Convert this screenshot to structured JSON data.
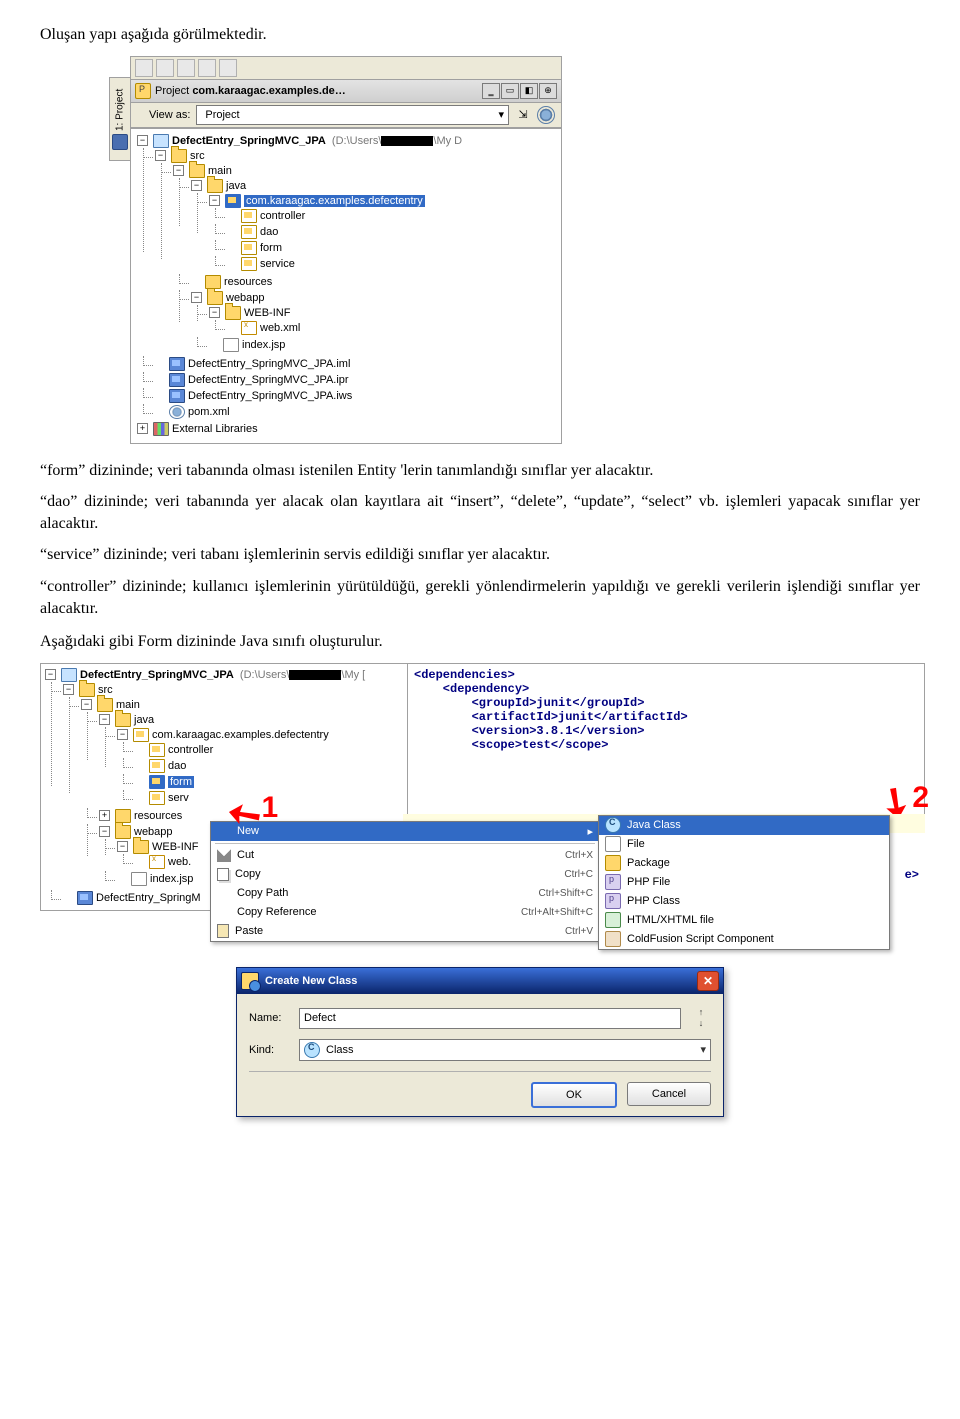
{
  "intro_line": "Oluşan yapı aşağıda görülmektedir.",
  "panel": {
    "title_prefix": "Project",
    "title_project": "com.karaagac.examples.de…",
    "view_label": "View as:",
    "view_value": "Project",
    "side_tab": "1: Project",
    "root": {
      "name": "DefectEntry_SpringMVC_JPA",
      "path_prefix": "(D:\\Users\\",
      "path_suffix": "\\My D"
    },
    "nodes": {
      "src": "src",
      "main": "main",
      "java": "java",
      "pkg": "com.karaagac.examples.defectentry",
      "controller": "controller",
      "dao": "dao",
      "form": "form",
      "service": "service",
      "resources": "resources",
      "webapp": "webapp",
      "webinf": "WEB-INF",
      "webxml": "web.xml",
      "indexjsp": "index.jsp",
      "iml": "DefectEntry_SpringMVC_JPA.iml",
      "ipr": "DefectEntry_SpringMVC_JPA.ipr",
      "iws": "DefectEntry_SpringMVC_JPA.iws",
      "pom": "pom.xml",
      "extlib": "External Libraries"
    }
  },
  "para": {
    "form": "“form” dizininde; veri tabanında olması istenilen Entity 'lerin tanımlandığı sınıflar yer alacaktır.",
    "dao": "“dao” dizininde; veri tabanında yer alacak olan kayıtlara ait “insert”, “delete”, “update”, “select” vb. işlemleri yapacak sınıflar yer alacaktır.",
    "service": "“service” dizininde; veri tabanı işlemlerinin servis edildiği sınıflar yer alacaktır.",
    "controller": "“controller” dizininde; kullanıcı işlemlerinin yürütüldüğü, gerekli yönlendirmelerin yapıldığı ve gerekli verilerin işlendiği sınıflar yer alacaktır.",
    "closing": "Aşağıdaki gibi Form dizininde Java sınıfı oluşturulur."
  },
  "shot2": {
    "tree": {
      "root": "DefectEntry_SpringMVC_JPA",
      "path_prefix": "(D:\\Users\\",
      "path_suffix": "\\My [",
      "src": "src",
      "main": "main",
      "java": "java",
      "pkg": "com.karaagac.examples.defectentry",
      "controller": "controller",
      "dao": "dao",
      "form": "form",
      "serv": "serv",
      "resources": "resources",
      "webapp": "webapp",
      "webinf": "WEB-INF",
      "webx": "web.",
      "indexjsp": "index.jsp",
      "springm": "DefectEntry_SpringM"
    },
    "xml_lines": [
      "<dependencies>",
      "    <dependency>",
      "        <groupId>junit</groupId>",
      "        <artifactId>junit</artifactId>",
      "        <version>3.8.1</version>",
      "        <scope>test</scope>"
    ],
    "e_suffix": "e>",
    "arrow1": "1",
    "arrow2": "2",
    "ctx": {
      "new": "New",
      "cut": "Cut",
      "cut_sc": "Ctrl+X",
      "copy": "Copy",
      "copy_sc": "Ctrl+C",
      "copypath": "Copy Path",
      "copypath_sc": "Ctrl+Shift+C",
      "copyref": "Copy Reference",
      "copyref_sc": "Ctrl+Alt+Shift+C",
      "paste": "Paste",
      "paste_sc": "Ctrl+V"
    },
    "sub": {
      "javaclass": "Java Class",
      "file": "File",
      "package": "Package",
      "phpfile": "PHP File",
      "phpclass": "PHP Class",
      "htmlfile": "HTML/XHTML file",
      "cfscript": "ColdFusion Script Component"
    }
  },
  "dialog": {
    "title": "Create New Class",
    "name_label": "Name:",
    "name_value": "Defect",
    "kind_label": "Kind:",
    "kind_value": "Class",
    "ok": "OK",
    "cancel": "Cancel"
  }
}
